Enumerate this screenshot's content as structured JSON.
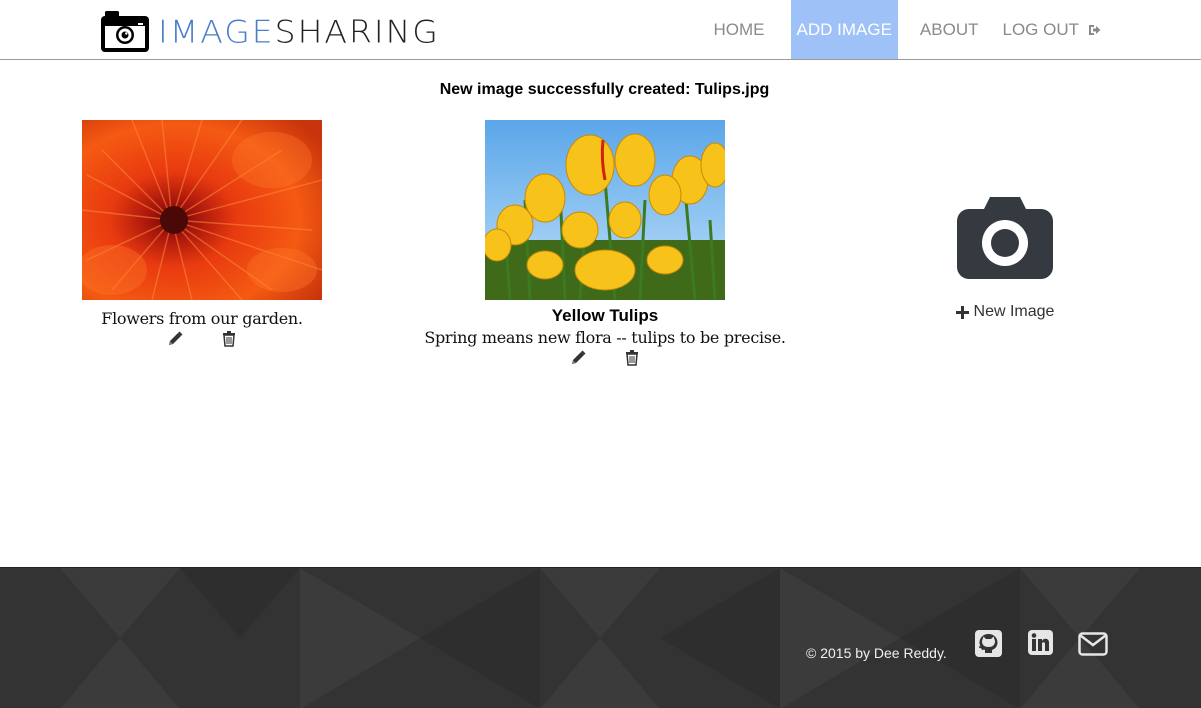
{
  "header": {
    "logo_word1": "IMAGE",
    "logo_word2": "SHARING",
    "nav": {
      "home": "HOME",
      "add_image": "ADD IMAGE",
      "about": "ABOUT",
      "logout": "LOG OUT"
    }
  },
  "flash_message": "New image successfully created: Tulips.jpg",
  "gallery": [
    {
      "title": "",
      "description": "Flowers from our garden.",
      "image": "orange-chrysanthemum"
    },
    {
      "title": "Yellow Tulips",
      "description": "Spring means new flora -- tulips to be precise.",
      "image": "yellow-tulips"
    }
  ],
  "new_image": {
    "label": "New Image",
    "icon": "camera-icon"
  },
  "footer": {
    "copyright": "© 2015 by Dee Reddy.",
    "icons": [
      "github-icon",
      "linkedin-icon",
      "envelope-icon"
    ]
  },
  "colors": {
    "brand_blue": "#4a7cc8",
    "nav_active_bg": "#9ec1f7",
    "footer_bg": "#333333"
  }
}
